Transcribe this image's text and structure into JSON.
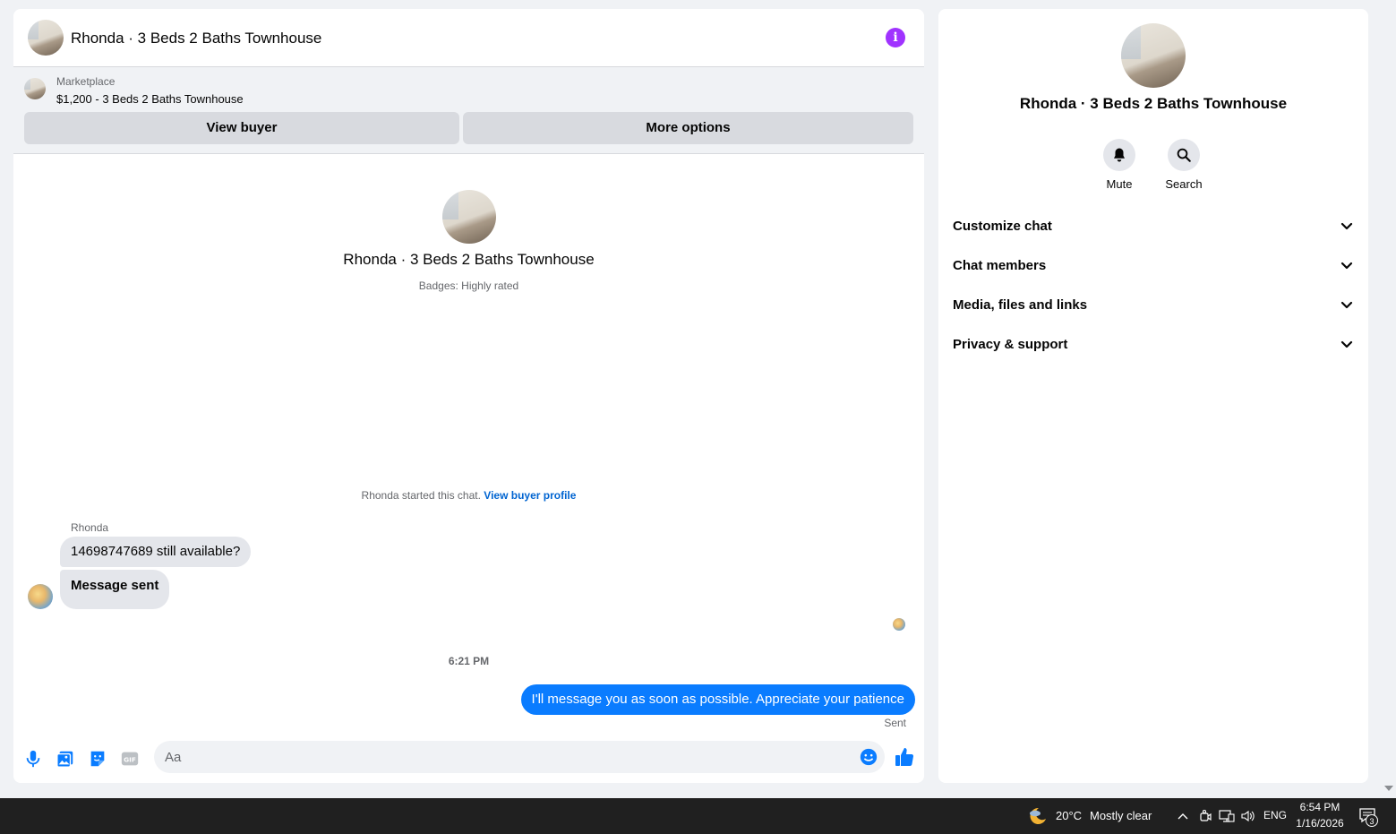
{
  "conversation": {
    "title": "Rhonda · 3 Beds 2 Baths Townhouse",
    "info_icon": "info-icon"
  },
  "marketplace": {
    "label": "Marketplace",
    "listing": "$1,200 - 3 Beds 2 Baths Townhouse",
    "view_buyer": "View buyer",
    "more_options": "More options"
  },
  "intro": {
    "name": "Rhonda · 3 Beds 2 Baths Townhouse",
    "badges": "Badges: Highly rated",
    "started_text": "Rhonda started this chat.",
    "profile_link": "View buyer profile"
  },
  "messages": {
    "sender": "Rhonda",
    "incoming": [
      "14698747689 still available?",
      "Message sent"
    ],
    "timestamp": "6:21 PM",
    "outgoing": "I'll message you as soon as possible. Appreciate your patience",
    "status": "Sent"
  },
  "composer": {
    "placeholder": "Aa",
    "icons": [
      "microphone-icon",
      "photo-icon",
      "sticker-icon",
      "gif-icon",
      "emoji-icon",
      "thumbs-up-icon"
    ]
  },
  "info_panel": {
    "name": "Rhonda · 3 Beds 2 Baths Townhouse",
    "actions": [
      {
        "label": "Mute",
        "icon": "bell-icon"
      },
      {
        "label": "Search",
        "icon": "search-icon"
      }
    ],
    "sections": [
      "Customize chat",
      "Chat members",
      "Media, files and links",
      "Privacy & support"
    ]
  },
  "taskbar": {
    "weather_temp": "20°C",
    "weather_desc": "Mostly clear",
    "language": "ENG",
    "time": "6:54 PM",
    "date": "1/16/2026",
    "notification_count": "3"
  },
  "colors": {
    "accent": "#0a7cff",
    "info": "#a033ff",
    "link": "#0064d1"
  }
}
